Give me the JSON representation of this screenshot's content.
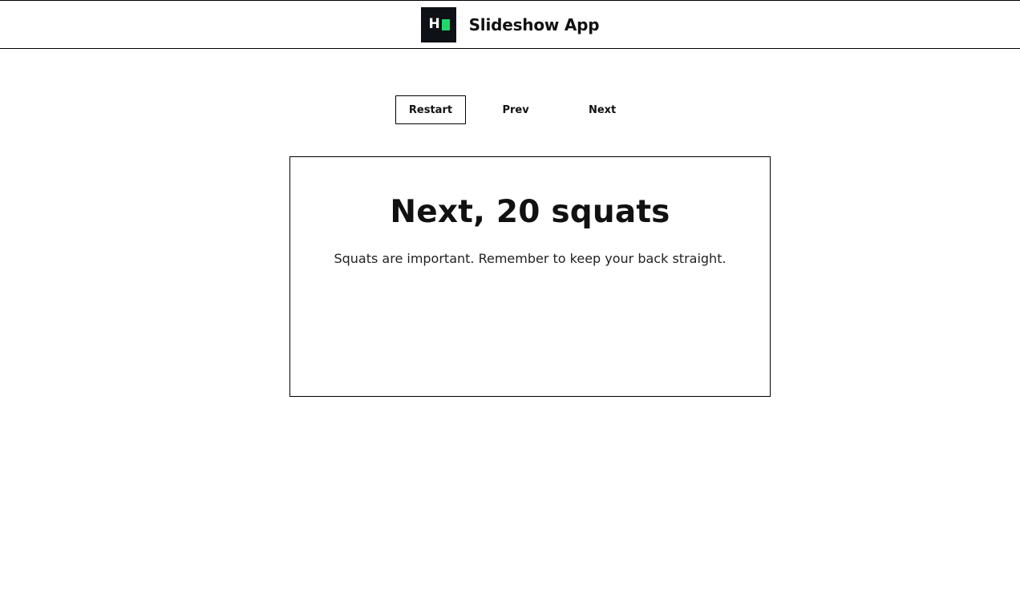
{
  "header": {
    "logo_text": "H",
    "title": "Slideshow App",
    "colors": {
      "logo_bg": "#0e1116",
      "logo_accent": "#1dd96a"
    }
  },
  "nav": {
    "restart_label": "Restart",
    "prev_label": "Prev",
    "next_label": "Next",
    "active": "restart"
  },
  "slide": {
    "title": "Next, 20 squats",
    "text": "Squats are important. Remember to keep your back straight."
  }
}
